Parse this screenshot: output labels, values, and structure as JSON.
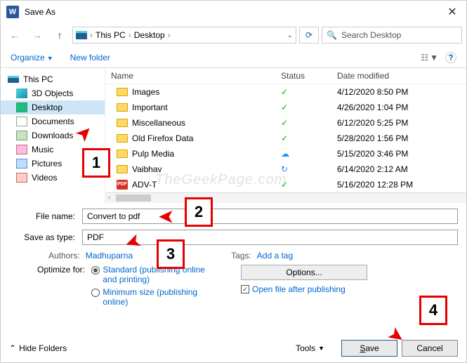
{
  "title": "Save As",
  "breadcrumb": {
    "root": "This PC",
    "path": "Desktop"
  },
  "search": {
    "placeholder": "Search Desktop"
  },
  "toolbar": {
    "organize": "Organize",
    "new_folder": "New folder"
  },
  "tree": {
    "root": "This PC",
    "items": [
      "3D Objects",
      "Desktop",
      "Documents",
      "Downloads",
      "Music",
      "Pictures",
      "Videos"
    ]
  },
  "columns": {
    "name": "Name",
    "status": "Status",
    "date": "Date modified"
  },
  "files": [
    {
      "name": "Images",
      "status": "✓",
      "date": "4/12/2020 8:50 PM",
      "type": "folder"
    },
    {
      "name": "Important",
      "status": "✓",
      "date": "4/26/2020 1:04 PM",
      "type": "folder"
    },
    {
      "name": "Miscellaneous",
      "status": "✓",
      "date": "6/12/2020 5:25 PM",
      "type": "folder"
    },
    {
      "name": "Old Firefox Data",
      "status": "✓",
      "date": "5/28/2020 1:56 PM",
      "type": "folder"
    },
    {
      "name": "Pulp Media",
      "status": "☁",
      "date": "5/15/2020 3:46 PM",
      "type": "folder"
    },
    {
      "name": "Vaibhav",
      "status": "↻",
      "date": "6/14/2020 2:12 AM",
      "type": "folder"
    },
    {
      "name": "ADV-T",
      "status": "✓",
      "date": "5/16/2020 12:28 PM",
      "type": "pdf"
    }
  ],
  "form": {
    "file_name_lbl": "File name:",
    "file_name_val": "Convert to pdf",
    "save_type_lbl": "Save as type:",
    "save_type_val": "PDF",
    "authors_lbl": "Authors:",
    "authors_val": "Madhuparna",
    "tags_lbl": "Tags:",
    "tags_val": "Add a tag",
    "optimize_lbl": "Optimize for:",
    "radio1": "Standard (publishing online and printing)",
    "radio2": "Minimum size (publishing online)",
    "options_btn": "Options...",
    "open_after": "Open file after publishing"
  },
  "footer": {
    "hide": "Hide Folders",
    "tools": "Tools",
    "save": "Save",
    "cancel": "Cancel"
  },
  "callouts": {
    "1": "1",
    "2": "2",
    "3": "3",
    "4": "4"
  },
  "watermark": "TheGeekPage.com"
}
